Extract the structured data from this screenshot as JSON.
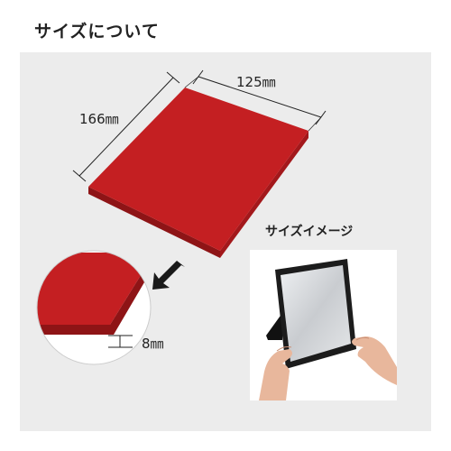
{
  "header": {
    "title": "サイズについて"
  },
  "dimensions": {
    "width_label": "125㎜",
    "height_label": "166㎜",
    "thickness_label": "8㎜"
  },
  "image_section": {
    "caption": "サイズイメージ"
  },
  "colors": {
    "panel_bg": "#ececec",
    "product_red": "#c41f22",
    "product_edge": "#8e1416",
    "mirror_frame": "#1c1c1c",
    "mirror_glass": "#d6d8da",
    "skin": "#e8b79c"
  }
}
